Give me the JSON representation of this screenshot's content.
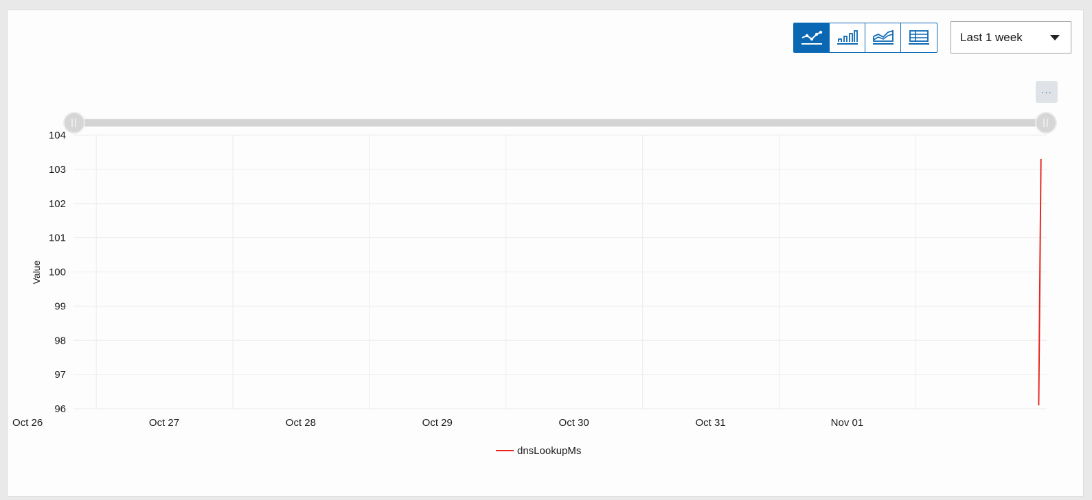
{
  "toolbar": {
    "views": [
      {
        "name": "line-chart-icon",
        "active": true
      },
      {
        "name": "bar-chart-icon",
        "active": false
      },
      {
        "name": "area-chart-icon",
        "active": false
      },
      {
        "name": "table-icon",
        "active": false
      }
    ],
    "range_label": "Last 1 week",
    "more_label": "···"
  },
  "colors": {
    "accent": "#0a67b3",
    "series": "#e8281f",
    "grid": "#ececec",
    "slider": "#d4d4d4"
  },
  "chart_data": {
    "type": "line",
    "ylabel": "Value",
    "xlabel": "",
    "ylim": [
      96,
      104
    ],
    "yticks": [
      96,
      97,
      98,
      99,
      100,
      101,
      102,
      103,
      104
    ],
    "xrange": [
      "2024-10-25T20:00",
      "2024-11-01T23:00"
    ],
    "xticks": [
      {
        "label": "Oct 26",
        "t": "2024-10-26T00:00"
      },
      {
        "label": "Oct 27",
        "t": "2024-10-27T00:00"
      },
      {
        "label": "Oct 28",
        "t": "2024-10-28T00:00"
      },
      {
        "label": "Oct 29",
        "t": "2024-10-29T00:00"
      },
      {
        "label": "Oct 30",
        "t": "2024-10-30T00:00"
      },
      {
        "label": "Oct 31",
        "t": "2024-10-31T00:00"
      },
      {
        "label": "Nov 01",
        "t": "2024-11-01T00:00"
      }
    ],
    "series": [
      {
        "name": "dnsLookupMs",
        "points": [
          {
            "t": "2024-11-01T21:36",
            "y": 96.1
          },
          {
            "t": "2024-11-01T22:00",
            "y": 103.3
          }
        ]
      }
    ],
    "grid": true,
    "legend": "bottom-center"
  }
}
